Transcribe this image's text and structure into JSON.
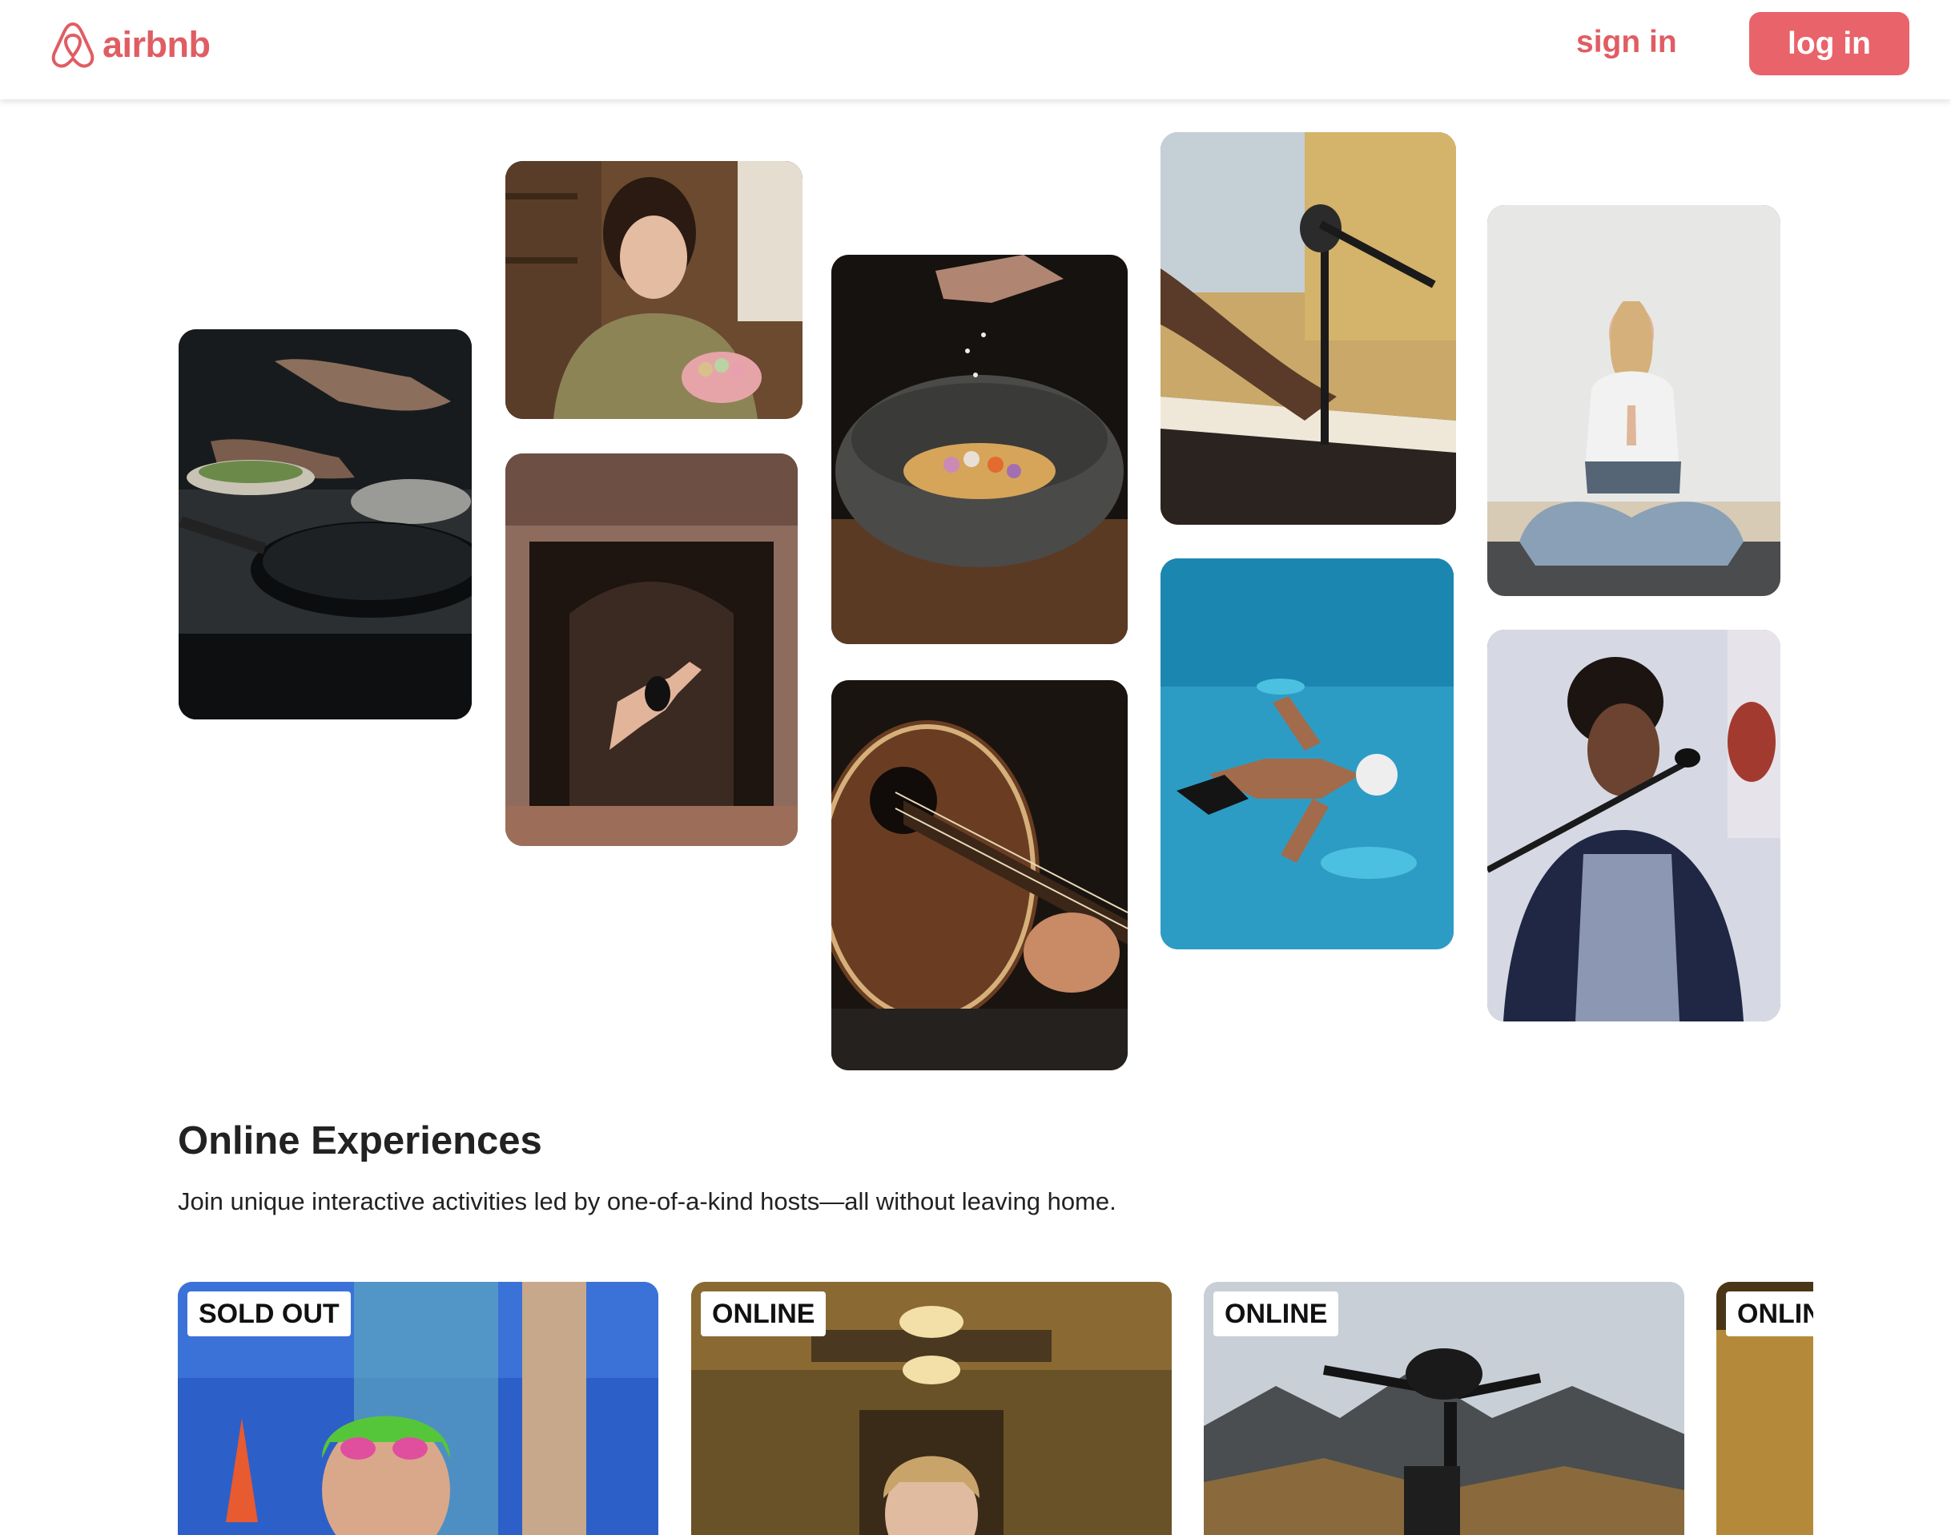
{
  "header": {
    "logo_text": "airbnb",
    "sign_in_label": "sign in",
    "login_label": "log in",
    "accent_color": "#e05d63"
  },
  "gallery": [
    {
      "subject": "hands cooking with pan",
      "theme": "cooking"
    },
    {
      "subject": "woman holding macarons",
      "theme": "baking"
    },
    {
      "subject": "dancer leaping in doorway",
      "theme": "dance"
    },
    {
      "subject": "seasoning stone bowl",
      "theme": "cooking"
    },
    {
      "subject": "acoustic guitar",
      "theme": "music"
    },
    {
      "subject": "hands on keyboard with microphone",
      "theme": "music"
    },
    {
      "subject": "swimmer in pool",
      "theme": "sports"
    },
    {
      "subject": "woman meditating",
      "theme": "yoga"
    },
    {
      "subject": "singer with microphone",
      "theme": "music"
    }
  ],
  "section": {
    "title": "Online Experiences",
    "subtitle": "Join unique interactive activities led by one-of-a-kind hosts—all without leaving home."
  },
  "cards": [
    {
      "badge": "SOLD OUT"
    },
    {
      "badge": "ONLINE"
    },
    {
      "badge": "ONLINE"
    },
    {
      "badge": "ONLINE"
    }
  ]
}
